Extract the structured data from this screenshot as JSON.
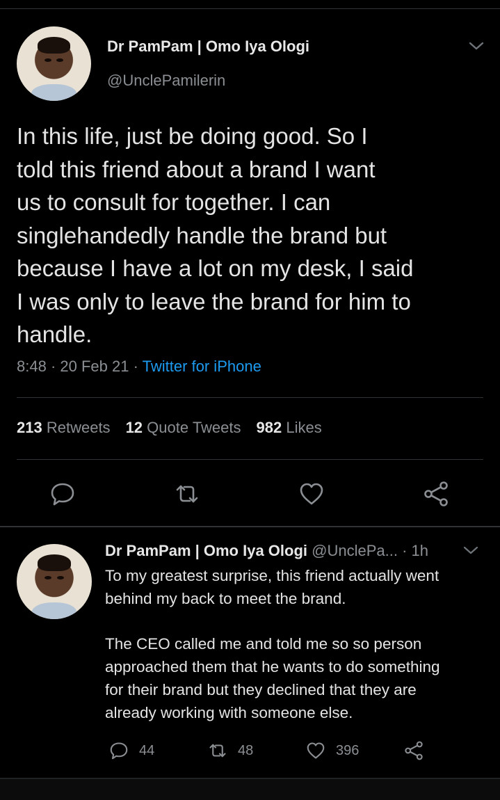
{
  "main_tweet": {
    "display_name": "Dr PamPam | Omo Iya Ologi",
    "handle": "@UnclePamilerin",
    "text": "In this life, just be doing good. So I\ntold this friend about a brand I want\nus to consult for together. I can\nsinglehandedly handle the brand but\nbecause I have a lot on my desk, I said\nI was only to leave the brand for him to\nhandle.",
    "time": "8:48",
    "date": "20 Feb 21",
    "source": "Twitter for iPhone",
    "stats": {
      "retweets_count": "213",
      "retweets_label": "Retweets",
      "quotes_count": "12",
      "quotes_label": "Quote Tweets",
      "likes_count": "982",
      "likes_label": "Likes"
    },
    "actions": [
      "reply-icon",
      "retweet-icon",
      "like-icon",
      "share-icon"
    ]
  },
  "reply_tweet": {
    "display_name": "Dr PamPam | Omo Iya Ologi",
    "handle": "@UnclePa...",
    "time_ago": "1h",
    "text": "To my greatest surprise, this friend actually went\nbehind my back to meet the brand.\n\nThe CEO called me and told me so so person\napproached them that he wants to do something\nfor their brand but they declined that they are\nalready working with someone else.",
    "counts": {
      "replies": "44",
      "retweets": "48",
      "likes": "396"
    }
  },
  "colors": {
    "background": "#000000",
    "text": "#e4e4e4",
    "muted": "#8b8f93",
    "accent": "#1d9bf0",
    "divider": "#2f3336"
  }
}
